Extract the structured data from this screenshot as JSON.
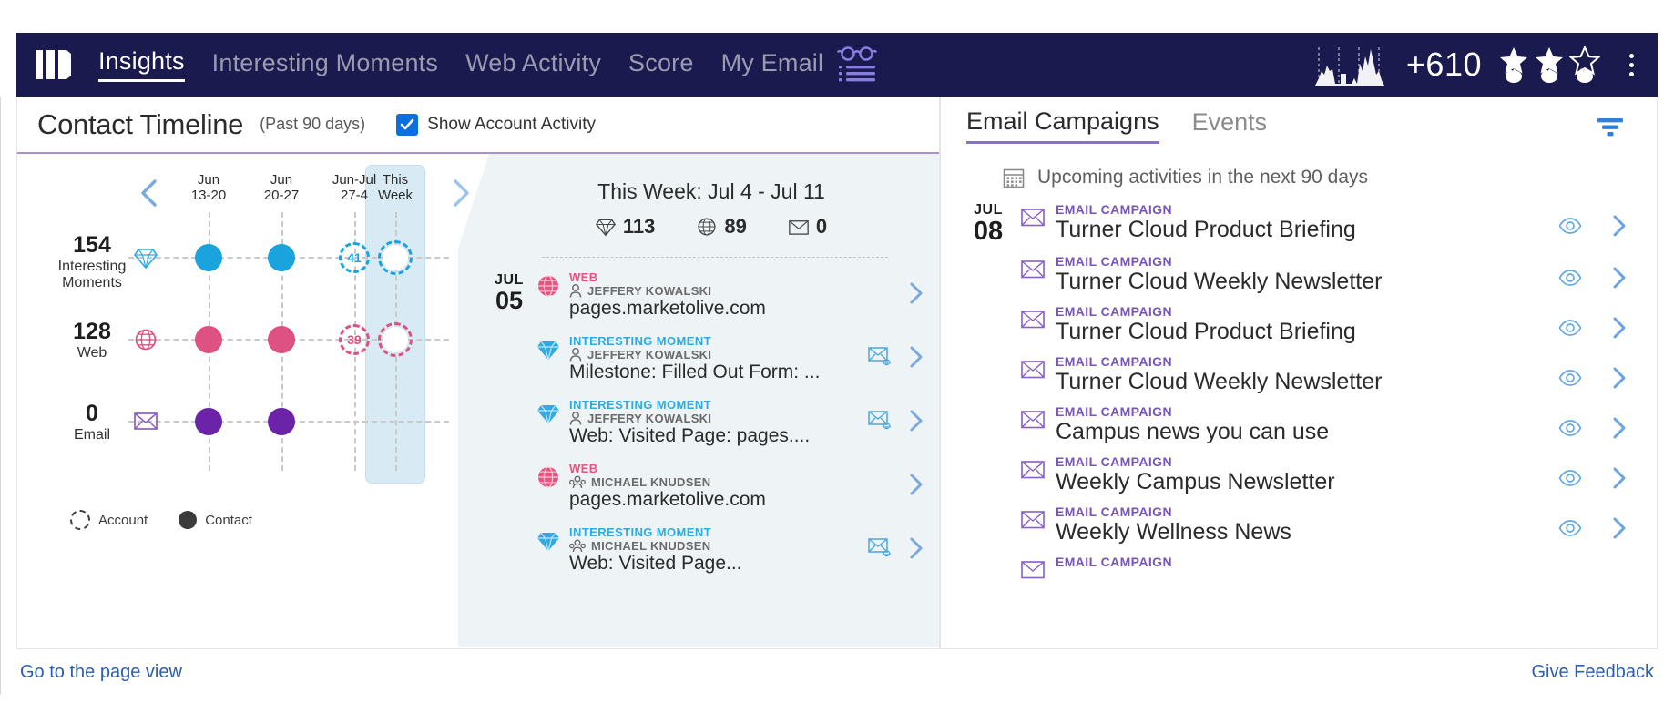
{
  "topnav": {
    "logo_icon": "bars-logo-icon",
    "items": [
      {
        "label": "Insights",
        "active": true
      },
      {
        "label": "Interesting Moments",
        "active": false
      },
      {
        "label": "Web Activity",
        "active": false
      },
      {
        "label": "Score",
        "active": false
      },
      {
        "label": "My Email",
        "active": false
      }
    ],
    "reading_list_icon": "glasses-list-icon",
    "sparkline_icon": "sparkline-chart-icon",
    "score": "+610",
    "stars_filled": 2,
    "stars_total": 3,
    "menu_icon": "kebab-menu-icon"
  },
  "timeline_card": {
    "title": "Contact Timeline",
    "subtitle": "(Past 90 days)",
    "checkbox_label": "Show Account Activity",
    "checkbox_checked": true,
    "prev_icon": "chevron-left-icon",
    "next_icon": "chevron-right-icon",
    "legend": [
      {
        "label": "Account",
        "style": "dashed"
      },
      {
        "label": "Contact",
        "style": "filled"
      }
    ]
  },
  "chart_data": {
    "type": "scatter",
    "title": "Contact Timeline (Past 90 days)",
    "categories": [
      "Jun\n13-20",
      "Jun\n20-27",
      "Jun-Jul\n27-4",
      "This\nWeek"
    ],
    "category_labels": [
      {
        "line1": "Jun",
        "line2": "13-20"
      },
      {
        "line1": "Jun",
        "line2": "20-27"
      },
      {
        "line1": "Jun-Jul",
        "line2": "27-4"
      },
      {
        "line1": "This",
        "line2": "Week"
      }
    ],
    "highlight_category": "This Week",
    "series": [
      {
        "name": "Interesting Moments",
        "total": "154",
        "icon": "diamond-icon",
        "color": "#1ba3dd",
        "points": [
          {
            "category": "Jun 13-20",
            "value": null,
            "style": "contact-filled"
          },
          {
            "category": "Jun 20-27",
            "value": null,
            "style": "contact-filled"
          },
          {
            "category": "Jun-Jul 27-4",
            "value": "41",
            "style": "account-dashed"
          },
          {
            "category": "This Week",
            "value": "113",
            "style": "account-ring-filled"
          }
        ]
      },
      {
        "name": "Web",
        "total": "128",
        "icon": "globe-icon",
        "color": "#dd5183",
        "points": [
          {
            "category": "Jun 13-20",
            "value": null,
            "style": "contact-filled"
          },
          {
            "category": "Jun 20-27",
            "value": null,
            "style": "contact-filled"
          },
          {
            "category": "Jun-Jul 27-4",
            "value": "39",
            "style": "account-dashed"
          },
          {
            "category": "This Week",
            "value": "89",
            "style": "account-ring-filled"
          }
        ]
      },
      {
        "name": "Email",
        "total": "0",
        "icon": "envelope-icon",
        "color": "#6b23a8",
        "points": [
          {
            "category": "Jun 13-20",
            "value": null,
            "style": "contact-filled"
          },
          {
            "category": "Jun 20-27",
            "value": null,
            "style": "contact-filled"
          },
          {
            "category": "Jun-Jul 27-4",
            "value": null,
            "style": "none"
          },
          {
            "category": "This Week",
            "value": null,
            "style": "none"
          }
        ]
      }
    ],
    "grid": true,
    "legend_position": "bottom-left"
  },
  "feed": {
    "title": "This Week: Jul 4 - Jul 11",
    "stats": [
      {
        "icon": "diamond-icon",
        "value": "113"
      },
      {
        "icon": "globe-icon",
        "value": "89"
      },
      {
        "icon": "envelope-icon",
        "value": "0"
      }
    ],
    "items": [
      {
        "month": "JUL",
        "day": "05",
        "icon": "globe-icon",
        "icon_color": "#e8537f",
        "kind": "WEB",
        "kind_color": "#e8537f",
        "who": "JEFFERY KOWALSKI",
        "who_icon": "person-icon",
        "main": "pages.marketolive.com",
        "has_mail_action": false,
        "chevron_icon": "chevron-right-icon"
      },
      {
        "month": "",
        "day": "",
        "icon": "diamond-icon",
        "icon_color": "#2eabe2",
        "kind": "INTERESTING MOMENT",
        "kind_color": "#2eabe2",
        "who": "JEFFERY KOWALSKI",
        "who_icon": "person-icon",
        "main": "Milestone: Filled Out Form: ...",
        "has_mail_action": true,
        "chevron_icon": "chevron-right-icon"
      },
      {
        "month": "",
        "day": "",
        "icon": "diamond-icon",
        "icon_color": "#2eabe2",
        "kind": "INTERESTING MOMENT",
        "kind_color": "#2eabe2",
        "who": "JEFFERY KOWALSKI",
        "who_icon": "person-icon",
        "main": "Web: Visited Page: pages....",
        "has_mail_action": true,
        "chevron_icon": "chevron-right-icon"
      },
      {
        "month": "",
        "day": "",
        "icon": "globe-icon",
        "icon_color": "#e8537f",
        "kind": "WEB",
        "kind_color": "#e8537f",
        "who": "MICHAEL KNUDSEN",
        "who_icon": "people-icon",
        "main": "pages.marketolive.com",
        "has_mail_action": false,
        "chevron_icon": "chevron-right-icon"
      },
      {
        "month": "",
        "day": "",
        "icon": "diamond-icon",
        "icon_color": "#2eabe2",
        "kind": "INTERESTING MOMENT",
        "kind_color": "#2eabe2",
        "who": "MICHAEL KNUDSEN",
        "who_icon": "people-icon",
        "main": "Web: Visited Page...",
        "has_mail_action": true,
        "chevron_icon": "chevron-right-icon"
      }
    ]
  },
  "right_panel": {
    "tabs": [
      {
        "label": "Email Campaigns",
        "active": true
      },
      {
        "label": "Events",
        "active": false
      }
    ],
    "filter_icon": "filter-icon",
    "upcoming_icon": "calendar-icon",
    "upcoming_text": "Upcoming activities in the next 90 days",
    "campaigns": [
      {
        "month": "JUL",
        "day": "08",
        "kind": "EMAIL CAMPAIGN",
        "name": "Turner Cloud Product Briefing",
        "icon": "envelope-icon",
        "eye_icon": "eye-icon",
        "chevron_icon": "chevron-right-icon"
      },
      {
        "month": "",
        "day": "",
        "kind": "EMAIL CAMPAIGN",
        "name": "Turner Cloud Weekly Newsletter",
        "icon": "envelope-icon",
        "eye_icon": "eye-icon",
        "chevron_icon": "chevron-right-icon"
      },
      {
        "month": "",
        "day": "",
        "kind": "EMAIL CAMPAIGN",
        "name": "Turner Cloud Product Briefing",
        "icon": "envelope-icon",
        "eye_icon": "eye-icon",
        "chevron_icon": "chevron-right-icon"
      },
      {
        "month": "",
        "day": "",
        "kind": "EMAIL CAMPAIGN",
        "name": "Turner Cloud Weekly Newsletter",
        "icon": "envelope-icon",
        "eye_icon": "eye-icon",
        "chevron_icon": "chevron-right-icon"
      },
      {
        "month": "",
        "day": "",
        "kind": "EMAIL CAMPAIGN",
        "name": "Campus news you can use",
        "icon": "envelope-icon",
        "eye_icon": "eye-icon",
        "chevron_icon": "chevron-right-icon"
      },
      {
        "month": "",
        "day": "",
        "kind": "EMAIL CAMPAIGN",
        "name": "Weekly Campus Newsletter",
        "icon": "envelope-icon",
        "eye_icon": "eye-icon",
        "chevron_icon": "chevron-right-icon"
      },
      {
        "month": "",
        "day": "",
        "kind": "EMAIL CAMPAIGN",
        "name": "Weekly Wellness News",
        "icon": "envelope-icon",
        "eye_icon": "eye-icon",
        "chevron_icon": "chevron-right-icon"
      },
      {
        "month": "",
        "day": "",
        "kind": "EMAIL CAMPAIGN",
        "name": "",
        "icon": "envelope-icon",
        "eye_icon": "eye-icon",
        "chevron_icon": "chevron-right-icon"
      }
    ]
  },
  "footer": {
    "left_link": "Go to the page view",
    "right_link": "Give Feedback"
  },
  "colors": {
    "nav_bg": "#1b1a4e",
    "accent_purple": "#8b6fd0",
    "moments_blue": "#1ba3dd",
    "web_pink": "#dd5183",
    "email_purple": "#6b23a8",
    "link_blue": "#2b5fb0"
  }
}
